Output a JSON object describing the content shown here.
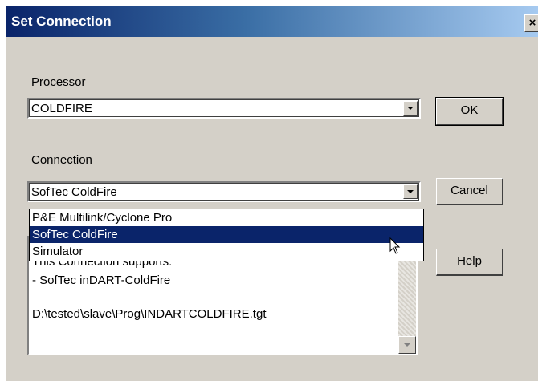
{
  "window": {
    "title": "Set Connection",
    "close_glyph": "×"
  },
  "processor": {
    "label": "Processor",
    "value": "COLDFIRE"
  },
  "connection": {
    "label": "Connection",
    "value": "SofTec ColdFire",
    "options": [
      "P&E Multilink/Cyclone Pro",
      "SofTec ColdFire",
      "Simulator"
    ],
    "selected_index": 1
  },
  "buttons": {
    "ok": "OK",
    "cancel": "Cancel",
    "help": "Help"
  },
  "description": {
    "lines": [
      "This Connection supports:",
      "- SofTec inDART-ColdFire",
      "",
      "D:\\tested\\slave\\Prog\\INDARTCOLDFIRE.tgt"
    ]
  },
  "colors": {
    "title_bar": "#0a246a",
    "dialog_face": "#d4d0c8",
    "selection": "#0a246a"
  },
  "icons": {
    "close": "close-icon",
    "dropdown": "chevron-down-icon",
    "cursor": "mouse-cursor-icon"
  }
}
